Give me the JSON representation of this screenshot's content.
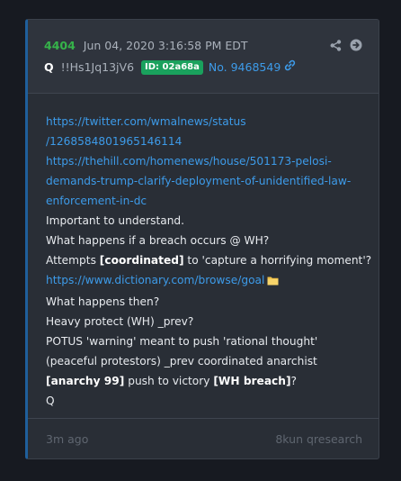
{
  "post": {
    "number": "4404",
    "date": "Jun 04, 2020 3:16:58 PM EDT",
    "author": "Q",
    "tripcode": "!!Hs1Jq13jV6",
    "id_badge": "ID: 02a68a",
    "post_no": "No. 9468549",
    "icons": [
      "share-icon",
      "arrow-right-circle-icon",
      "link-icon",
      "folder-icon"
    ],
    "colors": {
      "number": "#36b34a",
      "link": "#3d9be9",
      "badge": "#1aa15d",
      "accent_border": "#1f5f9c"
    }
  },
  "body": {
    "line1": "https://twitter.com/wmalnews/status",
    "line2": "/1268584801965146114",
    "line3": "https://thehill.com/homenews/house/501173-pelosi-",
    "line4": "demands-trump-clarify-deployment-of-unidentified-law-",
    "line5": "enforcement-in-dc",
    "line6": "Important to understand.",
    "line7": "What happens if a breach occurs @ WH?",
    "line8_pre": "Attempts ",
    "line8_bold": "[coordinated]",
    "line8_post": " to 'capture a horrifying moment'?",
    "line9": "https://www.dictionary.com/browse/goal",
    "line10": "What happens then?",
    "line11": "Heavy protect (WH) _prev?",
    "line12": "POTUS 'warning' meant to push 'rational thought'",
    "line13": "(peaceful protestors) _prev coordinated anarchist",
    "line14_bold1": "[anarchy 99]",
    "line14_mid": " push to victory ",
    "line14_bold2": "[WH breach]",
    "line14_post": "?",
    "line15": "Q"
  },
  "footer": {
    "time": "3m ago",
    "source": "8kun qresearch"
  }
}
